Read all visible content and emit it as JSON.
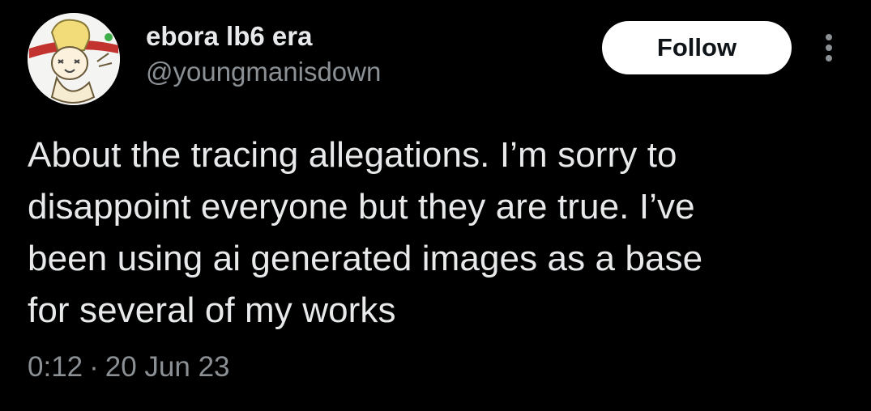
{
  "author": {
    "display_name": "ebora lb6 era",
    "handle": "@youngmanisdown",
    "avatar_icon": "cartoon-character-avatar"
  },
  "follow_button": {
    "label": "Follow"
  },
  "more_menu": {
    "icon": "vertical-ellipsis-icon"
  },
  "tweet": {
    "text": "About the tracing allegations. I’m sorry to\ndisappoint everyone but they are true. I’ve\nbeen using ai generated images as a base\nfor several of my works",
    "time": "0:12",
    "separator": "·",
    "date": "20 Jun 23"
  },
  "colors": {
    "background": "#000000",
    "primary_text": "#e7e9ea",
    "secondary_text": "#8b9095",
    "follow_bg": "#ffffff",
    "follow_text": "#0f1419"
  }
}
